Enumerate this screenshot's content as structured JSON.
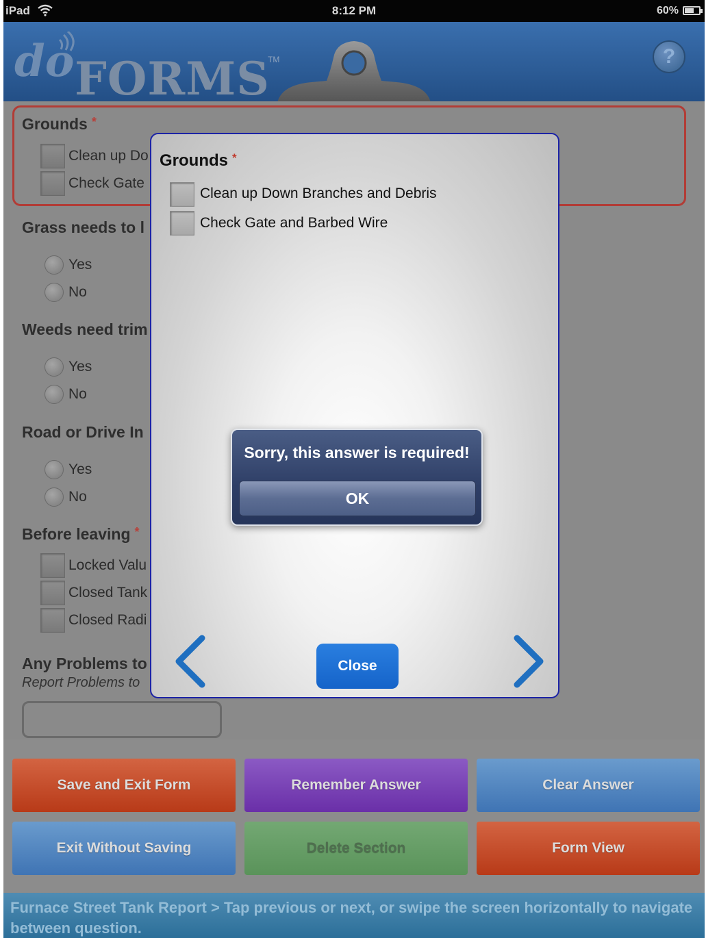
{
  "status_bar": {
    "carrier": "iPad",
    "time": "8:12 PM",
    "battery": "60%"
  },
  "header": {
    "logo_do": "do",
    "logo_forms": "FORMS",
    "logo_tm": "TM",
    "help_label": "?"
  },
  "form": {
    "grounds": {
      "title": "Grounds",
      "required_mark": "*",
      "options": [
        "Clean up Do",
        "Check Gate"
      ]
    },
    "grass": {
      "title": "Grass needs to l",
      "options": [
        "Yes",
        "No"
      ]
    },
    "weeds": {
      "title": "Weeds need trim",
      "options": [
        "Yes",
        "No"
      ]
    },
    "road": {
      "title": "Road or Drive In",
      "options": [
        "Yes",
        "No"
      ]
    },
    "before_leaving": {
      "title": "Before leaving",
      "required_mark": "*",
      "options": [
        "Locked Valu",
        "Closed Tank",
        "Closed Radi"
      ]
    },
    "problems": {
      "title": "Any Problems to",
      "hint": "Report Problems to"
    }
  },
  "buttons": {
    "save_exit": "Save and Exit Form",
    "remember": "Remember Answer",
    "clear": "Clear Answer",
    "exit_no_save": "Exit Without Saving",
    "delete_section": "Delete Section",
    "form_view": "Form View"
  },
  "footer": {
    "text": "Furnace Street Tank Report > Tap previous or next, or swipe the screen horizontally to navigate between question."
  },
  "modal": {
    "title": "Grounds",
    "required_mark": "*",
    "options": [
      "Clean up Down Branches and Debris",
      "Check Gate and Barbed Wire"
    ],
    "close_label": "Close"
  },
  "alert": {
    "message": "Sorry, this answer is required!",
    "ok_label": "OK"
  },
  "colors": {
    "required": "#c0392b",
    "modal_border": "#1c23a6",
    "close_button": "#1b6fd6",
    "nav_arrow": "#1f6fc0"
  }
}
